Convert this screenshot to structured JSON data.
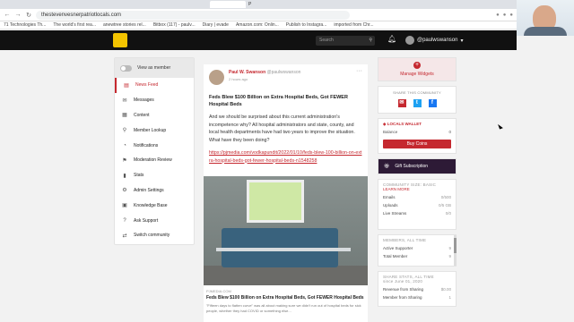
{
  "browser": {
    "tabs": [
      "",
      "",
      "",
      "",
      "",
      "",
      "",
      "",
      "",
      "",
      "",
      "P",
      "",
      "",
      "",
      "",
      "",
      "",
      "",
      ""
    ],
    "active_tab": "",
    "url": "thestevenvesnerpatriotlocals.com",
    "bookmarks": [
      "71 Technologies Th...",
      "The world's first rea...",
      "anewtree stories rel...",
      "Bitbox (117) - paulv...",
      "Diary | evade",
      "Amazon.com: Onlin...",
      "Publish to Instagra...",
      "imported from Chr..."
    ]
  },
  "site": {
    "search_placeholder": "Search",
    "username": "@paulwswanson",
    "logo_text": ""
  },
  "left_nav": {
    "toggle_label": "View as member",
    "items": [
      {
        "label": "News Feed",
        "icon": "rss-icon",
        "glyph": "▤"
      },
      {
        "label": "Messages",
        "icon": "messages-icon",
        "glyph": "✉"
      },
      {
        "label": "Content",
        "icon": "content-icon",
        "glyph": "▦"
      },
      {
        "label": "Member Lookup",
        "icon": "member-lookup-icon",
        "glyph": "⚲"
      },
      {
        "label": "Notifications",
        "icon": "notifications-icon",
        "glyph": "◔"
      },
      {
        "label": "Moderation Review",
        "icon": "moderation-icon",
        "glyph": "⚑"
      },
      {
        "label": "Stats",
        "icon": "stats-icon",
        "glyph": "▮"
      },
      {
        "label": "Admin Settings",
        "icon": "settings-icon",
        "glyph": "⚙"
      },
      {
        "label": "Knowledge Base",
        "icon": "book-icon",
        "glyph": "▣"
      },
      {
        "label": "Ask Support",
        "icon": "support-icon",
        "glyph": "?"
      },
      {
        "label": "Switch community",
        "icon": "switch-icon",
        "glyph": "⇄"
      }
    ]
  },
  "post": {
    "author": "Paul W. Swanson",
    "handle": "@paulwswanson",
    "time": "2 hours ago",
    "title": "Feds Blew $100 Billion on Extra Hospital Beds, Got FEWER Hospital Beds",
    "body": "And we should be surprised about this current administration's incompetence why? All hospital administrators and state, county, and local health departments have had two years to improve the situation. What have they been doing?",
    "link": "https://pjmedia.com/vodkapundit/2022/01/10/feds-blew-100-billion-on-extra-hospital-beds-got-fewer-hospital-beds-n1548258",
    "source": "PJMEDIA.COM",
    "card_title": "Feds Blew $100 Billion on Extra Hospital Beds, Got FEWER Hospital Beds",
    "card_desc": "\"Fifteen days to flatten curve\" was all about making sure we didn't run out of hospital beds for sick people, whether they had COVID or something else..."
  },
  "sidebar": {
    "manage_widgets": "Manage Widgets",
    "share_title": "SHARE THIS COMMUNITY",
    "wallet_title": "LOCALS WALLET",
    "balance_label": "Balance",
    "balance_value": "0",
    "buy_coins": "Buy Coins",
    "gift_subscription": "Gift Subscription",
    "community_title": "COMMUNITY SIZE: BASIC",
    "community_link": "LEARN MORE",
    "community_rows": [
      {
        "label": "Emails",
        "value": "0/500"
      },
      {
        "label": "Uploads",
        "value": "0/5 GB"
      },
      {
        "label": "Live Streams",
        "value": "0/0"
      }
    ],
    "members_title": "MEMBERS, ALL TIME",
    "members_rows": [
      {
        "label": "Active Supporter",
        "value": "9"
      },
      {
        "label": "Total Member",
        "value": "9"
      }
    ],
    "share_stats_title": "SHARE STATS, ALL TIME",
    "share_stats_sub": "since June 01, 2020",
    "share_rows": [
      {
        "label": "Revenue from Sharing",
        "value": "$0.00"
      },
      {
        "label": "Member from Sharing",
        "value": "1"
      }
    ]
  }
}
